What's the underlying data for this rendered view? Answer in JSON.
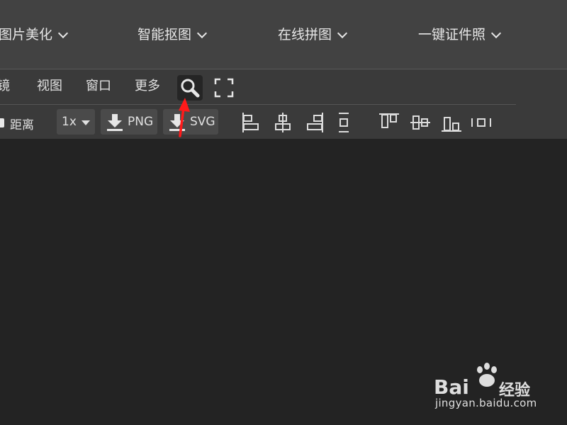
{
  "top_nav": {
    "items": [
      {
        "label": "图片美化"
      },
      {
        "label": "智能抠图"
      },
      {
        "label": "在线拼图"
      },
      {
        "label": "一键证件照"
      }
    ]
  },
  "menu_bar": {
    "items": [
      {
        "label": "镜"
      },
      {
        "label": "视图"
      },
      {
        "label": "窗口"
      },
      {
        "label": "更多"
      }
    ]
  },
  "toolbar": {
    "distance_label": "距离",
    "zoom_value": "1x",
    "export_png_label": "PNG",
    "export_svg_label": "SVG"
  },
  "annotation": {
    "arrow_color": "#ff1a1a"
  },
  "watermark": {
    "brand": "Bai",
    "brand_suffix": "经验",
    "url": "jingyan.baidu.com"
  }
}
